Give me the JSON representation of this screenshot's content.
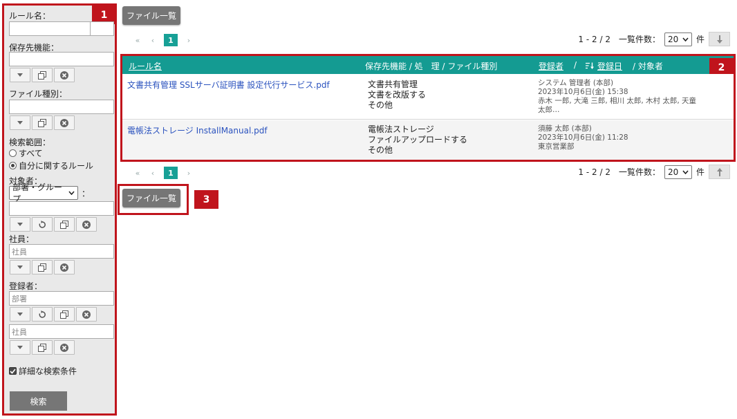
{
  "sidebar": {
    "callout": "1",
    "rule_name_label": "ルール名：",
    "storage_label": "保存先機能：",
    "file_type_label": "ファイル種別：",
    "scope_label": "検索範囲：",
    "scope_options": [
      "すべて",
      "自分に関するルール"
    ],
    "scope_selected": "自分に関するルール",
    "target_label": "対象者：",
    "target_select": "部署・グループ",
    "target_colon": "：",
    "employee_label": "社員：",
    "employee_placeholder": "社員",
    "registrant_label": "登録者：",
    "registrant_dept_placeholder": "部署",
    "registrant_emp_placeholder": "社員",
    "detail_checkbox": "詳細な検索条件",
    "search_button": "検索"
  },
  "main": {
    "file_list_button": "ファイル一覧",
    "callout_table": "2",
    "callout_button": "3",
    "pager": {
      "first": "«",
      "prev": "‹",
      "current": "1",
      "next": "›",
      "range": "1 - 2 / 2",
      "per_page_label": "一覧件数：",
      "per_page": "20",
      "unit": "件"
    },
    "table": {
      "headers": {
        "rule_name": "ルール名",
        "storage_process": "保存先機能 / 処　理 / ファイル種別",
        "registrant": "登録者",
        "slash": "/",
        "reg_date": "登録日",
        "target": "/ 対象者"
      },
      "rows": [
        {
          "rule": "文書共有管理 SSLサーバ証明書 設定代行サービス.pdf",
          "storage": "文書共有管理",
          "process": "文書を改版する",
          "file_type": "その他",
          "registrant": "システム 管理者 (本部)",
          "date": "2023年10月6日(金) 15:38",
          "targets": "赤木 一郎, 大滝 三郎, 相川 太郎, 木村 太郎, 天童 太郎…"
        },
        {
          "rule": "電帳法ストレージ InstallManual.pdf",
          "storage": "電帳法ストレージ",
          "process": "ファイルアップロードする",
          "file_type": "その他",
          "registrant": "須藤 太郎 (本部)",
          "date": "2023年10月6日(金) 11:28",
          "targets": "東京営業部"
        }
      ]
    }
  },
  "colors": {
    "accent": "#149b92",
    "callout": "#c0141c",
    "button": "#767676",
    "link": "#2a52be"
  }
}
